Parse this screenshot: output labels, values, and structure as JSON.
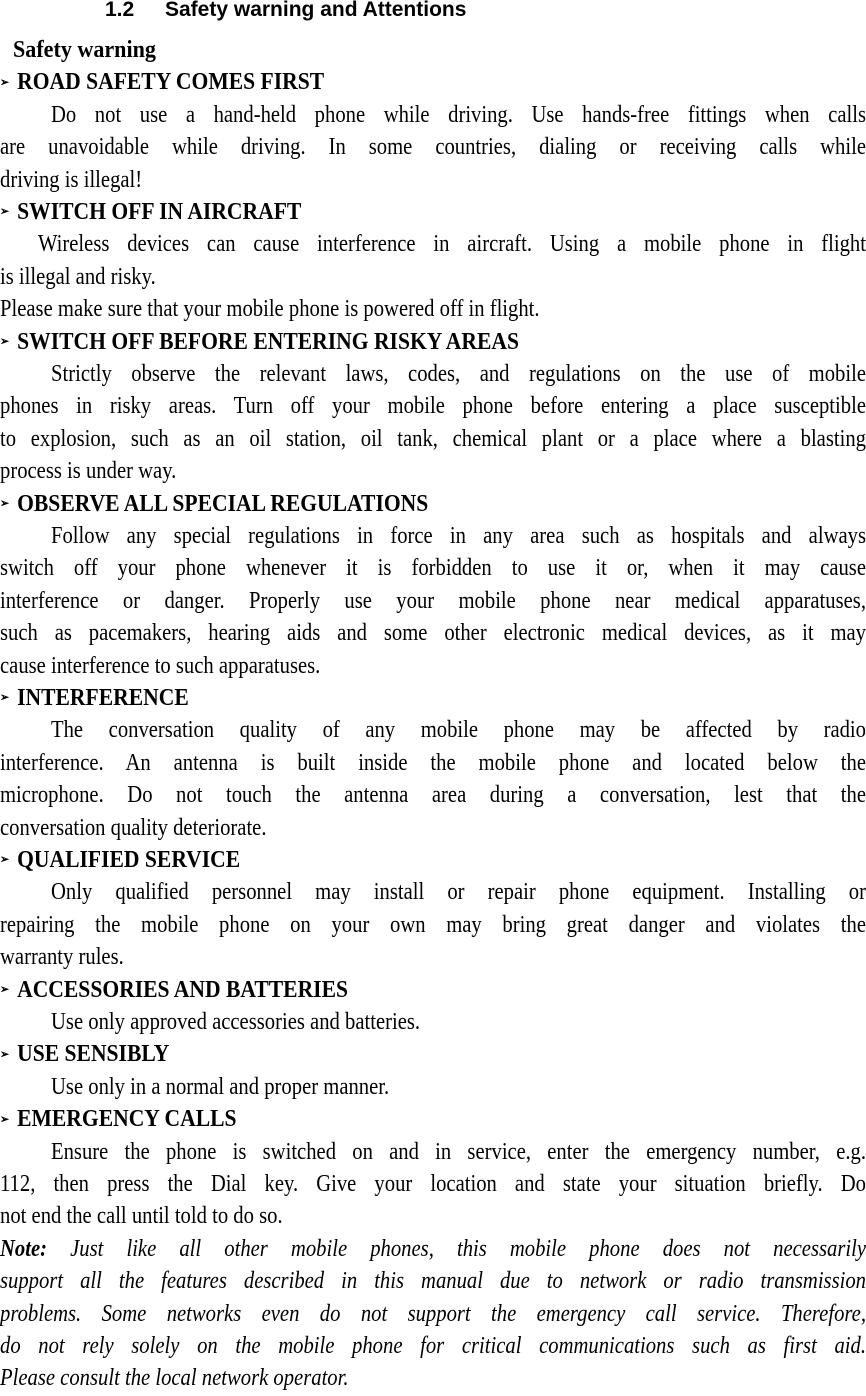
{
  "section": {
    "number": "1.2",
    "title": "Safety warning and Attentions"
  },
  "subtitle": "Safety warning",
  "bullet_icon": "➢",
  "items": [
    {
      "heading": "ROAD SAFETY COMES FIRST",
      "lines": [
        "Do not use a hand-held phone while driving. Use hands-free fittings when calls",
        "are unavoidable while driving. In some countries, dialing or receiving calls while",
        "driving is illegal!"
      ]
    },
    {
      "heading": "SWITCH OFF IN AIRCRAFT",
      "lines": [
        "Wireless devices can cause interference in aircraft. Using a mobile phone in flight",
        "is illegal and risky.",
        "Please make sure that your mobile phone is powered off in flight."
      ]
    },
    {
      "heading": "SWITCH OFF BEFORE ENTERING RISKY AREAS",
      "lines": [
        "Strictly observe the relevant laws, codes, and regulations on the use of mobile",
        "phones in risky areas. Turn off your mobile phone before entering a place susceptible",
        "to explosion, such as an oil station, oil tank, chemical plant or a place where a blasting",
        "process is under way."
      ]
    },
    {
      "heading": "OBSERVE ALL SPECIAL REGULATIONS",
      "lines": [
        "Follow any special regulations in force in any area such as hospitals and always",
        "switch off your phone whenever it is forbidden to use it or, when it may cause",
        "interference or danger. Properly use your mobile phone near medical apparatuses,",
        "such as pacemakers, hearing aids and some other electronic medical devices, as it may",
        "cause interference to such apparatuses."
      ]
    },
    {
      "heading": "INTERFERENCE",
      "lines": [
        "The conversation quality of any mobile phone may be affected by radio",
        "interference. An antenna is built inside the mobile phone and located below the",
        "microphone. Do not touch the antenna area during a conversation, lest that the",
        "conversation quality deteriorate."
      ]
    },
    {
      "heading": "QUALIFIED SERVICE",
      "lines": [
        "Only qualified personnel may install or repair phone equipment. Installing or",
        "repairing the mobile phone on your own may bring great danger and violates the",
        "warranty rules."
      ]
    },
    {
      "heading": "ACCESSORIES AND BATTERIES",
      "lines": [
        "Use only approved accessories and batteries."
      ]
    },
    {
      "heading": "USE SENSIBLY",
      "lines": [
        "Use only in a normal and proper manner."
      ]
    },
    {
      "heading": "EMERGENCY CALLS",
      "lines": [
        "Ensure the phone is switched on and in service, enter the emergency number, e.g.",
        "112, then press the Dial key. Give your location and state your situation briefly. Do",
        "not end the call until told to do so."
      ]
    }
  ],
  "note": {
    "label": "Note:",
    "lines": [
      "Just like all other mobile phones, this mobile phone does not necessarily",
      "support all the features described in this manual due to network or radio transmission",
      "problems. Some networks even do not support the emergency call service. Therefore,",
      "do not rely solely on the mobile phone for critical communications such as first aid.",
      "Please consult the local network operator."
    ]
  }
}
